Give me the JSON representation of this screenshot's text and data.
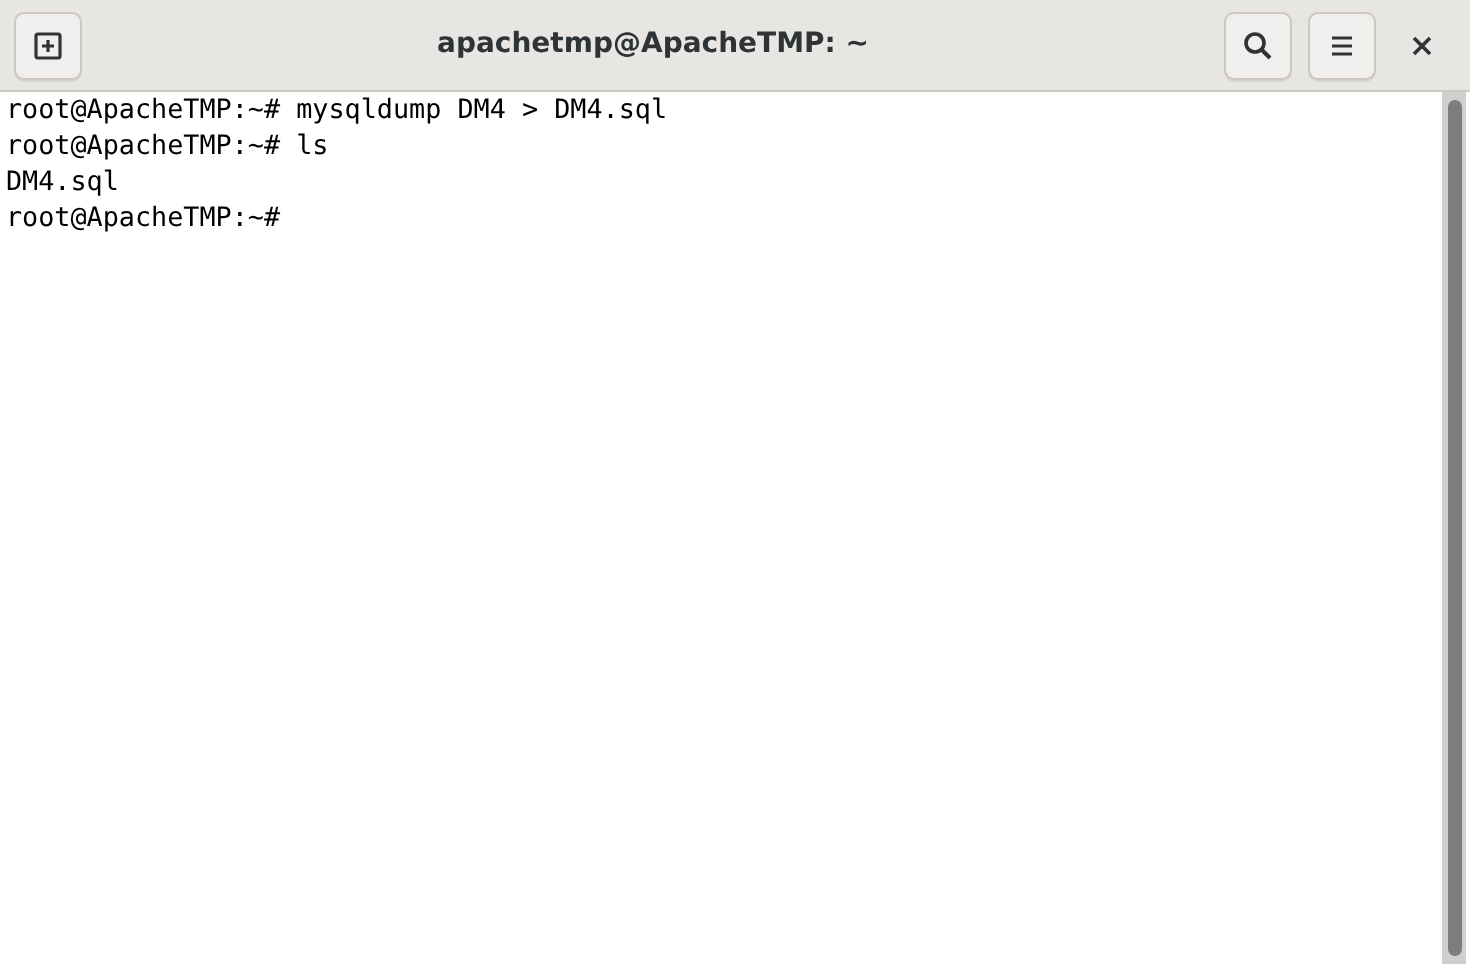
{
  "window": {
    "title": "apachetmp@ApacheTMP: ~"
  },
  "header_buttons": [
    {
      "kind": "search"
    },
    {
      "kind": "menu"
    }
  ],
  "terminal": {
    "lines": [
      "root@ApacheTMP:~# mysqldump DM4 > DM4.sql",
      "root@ApacheTMP:~# ls",
      "DM4.sql",
      "root@ApacheTMP:~#"
    ]
  }
}
